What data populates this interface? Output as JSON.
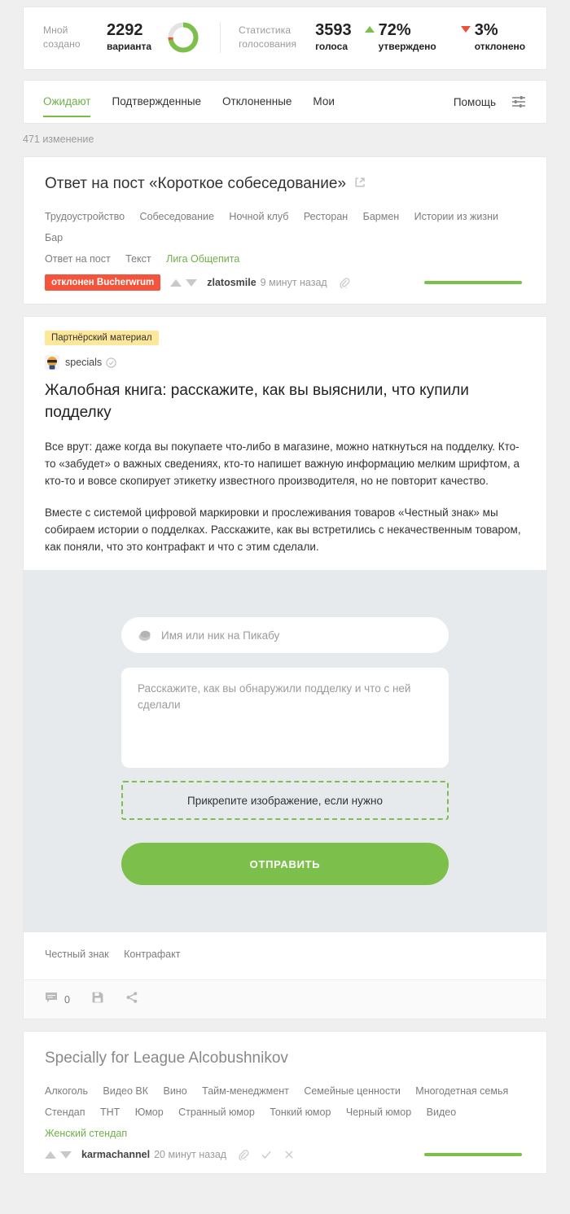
{
  "stats": {
    "created_label": "Мной\nсоздано",
    "created_label_l1": "Мной",
    "created_label_l2": "создано",
    "created_value": "2292",
    "created_unit": "варианта",
    "vote_label_l1": "Статистика",
    "vote_label_l2": "голосования",
    "vote_value": "3593",
    "vote_unit": "голоса",
    "approved_value": "72%",
    "approved_unit": "утверждено",
    "rejected_value": "3%",
    "rejected_unit": "отклонено",
    "donut": {
      "approved_pct": 72,
      "rejected_pct": 3,
      "remaining_pct": 25
    },
    "colors": {
      "green": "#7cc04b",
      "red": "#ef4f36",
      "gray": "#e3e3e3"
    }
  },
  "tabs": {
    "items": [
      {
        "label": "Ожидают",
        "active": true
      },
      {
        "label": "Подтвержденные",
        "active": false
      },
      {
        "label": "Отклоненные",
        "active": false
      },
      {
        "label": "Мои",
        "active": false
      }
    ],
    "help_label": "Помощь",
    "filter_icon": "sliders-icon"
  },
  "count_row": "471 изменение",
  "post1": {
    "title": "Ответ на пост «Короткое собеседование»",
    "open_icon": "external-link-icon",
    "tags": [
      {
        "label": "Трудоустройство",
        "green": false
      },
      {
        "label": "Собеседование",
        "green": false
      },
      {
        "label": "Ночной клуб",
        "green": false
      },
      {
        "label": "Ресторан",
        "green": false
      },
      {
        "label": "Бармен",
        "green": false
      },
      {
        "label": "Истории из жизни",
        "green": false
      },
      {
        "label": "Бар",
        "green": false
      },
      {
        "label": "Ответ на пост",
        "green": false
      },
      {
        "label": "Текст",
        "green": false
      },
      {
        "label": "Лига Общепита",
        "green": true
      }
    ],
    "badge": "отклонен Bucherwrum",
    "author": "zlatosmile",
    "time": "9 минут назад",
    "link_icon": "paperclip-icon"
  },
  "promo": {
    "badge": "Партнёрский материал",
    "avatar_icon": "sunglasses-avatar-icon",
    "author": "specials",
    "verified_icon": "verified-check-icon",
    "title": "Жалобная книга: расскажите, как вы выяснили, что купили подделку",
    "paragraphs": [
      "Все врут: даже когда вы покупаете что-либо в магазине, можно наткнуться на подделку. Кто-то «забудет» о важных сведениях, кто-то напишет важную информацию мелким шрифтом, а кто-то и вовсе скопирует этикетку известного производителя, но не повторит качество.",
      "Вместе с системой цифровой маркировки и прослеживания товаров «Честный знак» мы собираем истории о подделках. Расскажите, как вы встретились с некачественным товаром, как поняли, что это контрафакт и что с этим сделали."
    ],
    "form": {
      "name_icon": "pikabu-logo-icon",
      "name_placeholder": "Имя или ник на Пикабу",
      "name_value": "",
      "story_placeholder": "Расскажите, как вы обнаружили подделку и что с ней сделали",
      "story_value": "",
      "dropzone_label": "Прикрепите изображение, если нужно",
      "submit_label": "ОТПРАВИТЬ",
      "accent_color": "#7cc04b"
    },
    "tags": [
      {
        "label": "Честный знак",
        "green": false
      },
      {
        "label": "Контрафакт",
        "green": false
      }
    ],
    "actions": {
      "comments_icon": "comment-icon",
      "comments_count": "0",
      "save_icon": "save-icon",
      "share_icon": "share-icon"
    }
  },
  "post2": {
    "title": "Specially for League Alcobushnikov",
    "tags": [
      {
        "label": "Алкоголь",
        "green": false
      },
      {
        "label": "Видео ВК",
        "green": false
      },
      {
        "label": "Вино",
        "green": false
      },
      {
        "label": "Тайм-менеджмент",
        "green": false
      },
      {
        "label": "Семейные ценности",
        "green": false
      },
      {
        "label": "Многодетная семья",
        "green": false
      },
      {
        "label": "Стендап",
        "green": false
      },
      {
        "label": "ТНТ",
        "green": false
      },
      {
        "label": "Юмор",
        "green": false
      },
      {
        "label": "Странный юмор",
        "green": false
      },
      {
        "label": "Тонкий юмор",
        "green": false
      },
      {
        "label": "Черный юмор",
        "green": false
      },
      {
        "label": "Видео",
        "green": false
      },
      {
        "label": "Женский стендап",
        "green": true
      }
    ],
    "author": "karmachannel",
    "time": "20 минут назад",
    "link_icon": "paperclip-icon",
    "approve_icon": "check-icon",
    "reject_icon": "close-icon"
  }
}
